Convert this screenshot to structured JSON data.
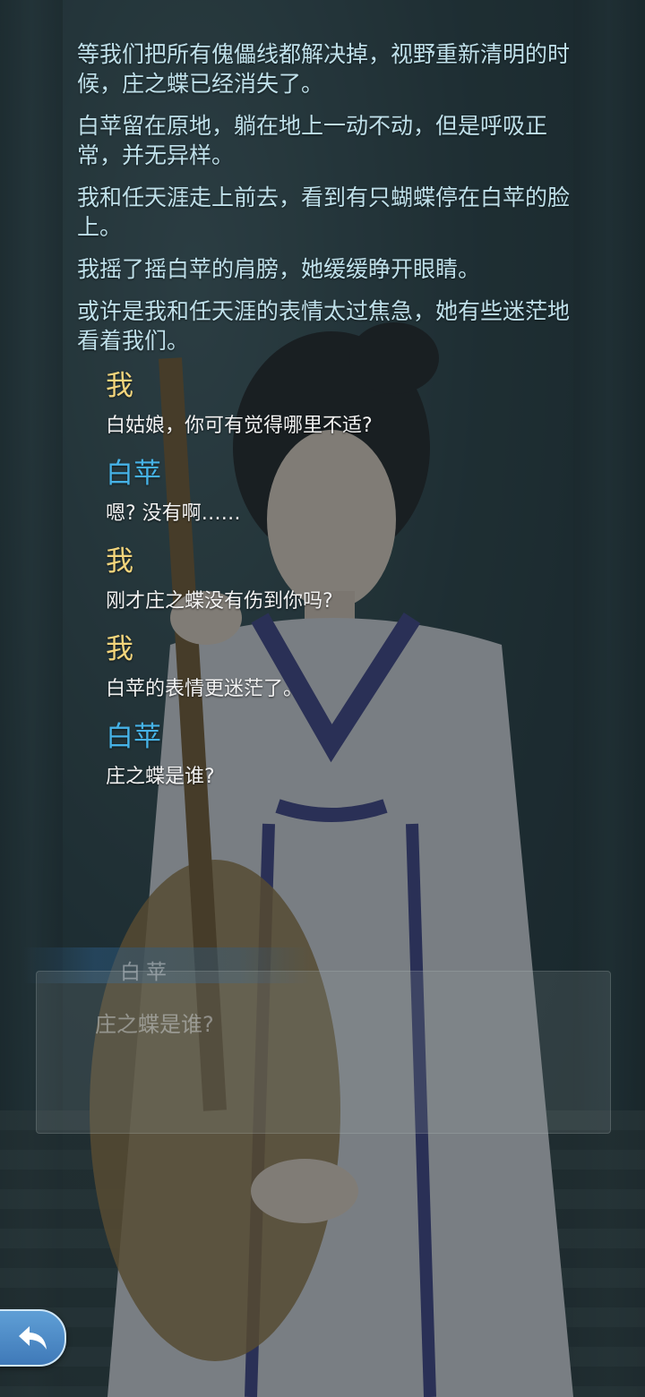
{
  "log": {
    "narration": [
      "等我们把所有傀儡线都解决掉，视野重新清明的时候，庄之蝶已经消失了。",
      "白苹留在原地，躺在地上一动不动，但是呼吸正常，并无异样。",
      "我和任天涯走上前去，看到有只蝴蝶停在白苹的脸上。",
      "我摇了摇白苹的肩膀，她缓缓睁开眼睛。",
      "或许是我和任天涯的表情太过焦急，她有些迷茫地看着我们。"
    ],
    "dialogues": [
      {
        "speaker": "我",
        "text": "白姑娘，你可有觉得哪里不适?"
      },
      {
        "speaker": "白苹",
        "text": "嗯? 没有啊……"
      },
      {
        "speaker": "我",
        "text": "刚才庄之蝶没有伤到你吗?"
      },
      {
        "speaker": "我",
        "text": "白苹的表情更迷茫了。"
      },
      {
        "speaker": "白苹",
        "text": "庄之蝶是谁?"
      }
    ]
  },
  "dialog_box": {
    "speaker": "白苹",
    "text": "庄之蝶是谁?"
  },
  "back_button": {
    "icon": "back-arrow-icon"
  },
  "colors": {
    "narration": "#bfe0ea",
    "speaker_me": "#f3d57c",
    "speaker_baiping": "#46b2e6",
    "dialogue": "#f2f2f2"
  }
}
